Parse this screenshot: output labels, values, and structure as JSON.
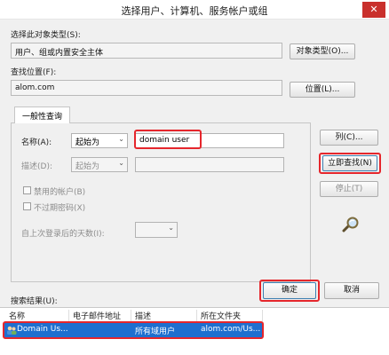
{
  "window": {
    "title": "选择用户、计算机、服务帐户或组",
    "close_glyph": "✕"
  },
  "object_type": {
    "label": "选择此对象类型(S):",
    "value": "用户、组或内置安全主体",
    "button": "对象类型(O)..."
  },
  "location": {
    "label": "查找位置(F):",
    "value": "alom.com",
    "button": "位置(L)..."
  },
  "tabs": [
    {
      "label": "一般性查询"
    }
  ],
  "query": {
    "name_label": "名称(A):",
    "name_mode": "起始为",
    "name_value": "domain user",
    "desc_label": "描述(D):",
    "desc_mode": "起始为",
    "desc_value": "",
    "disabled_accounts": "禁用的帐户(B)",
    "non_expiring_password": "不过期密码(X)",
    "days_since_login": "自上次登录后的天数(I):"
  },
  "side_buttons": {
    "columns": "列(C)...",
    "find_now": "立即查找(N)",
    "stop": "停止(T)"
  },
  "dialog_buttons": {
    "ok": "确定",
    "cancel": "取消"
  },
  "results": {
    "label": "搜索结果(U):",
    "columns": [
      "名称",
      "电子邮件地址",
      "描述",
      "所在文件夹"
    ],
    "rows": [
      {
        "name": "Domain Us...",
        "email": "",
        "description": "所有域用户",
        "folder": "alom.com/Us..."
      }
    ]
  },
  "colors": {
    "highlight": "#e5262c",
    "selection": "#1e6fcf",
    "close": "#c9302c"
  }
}
